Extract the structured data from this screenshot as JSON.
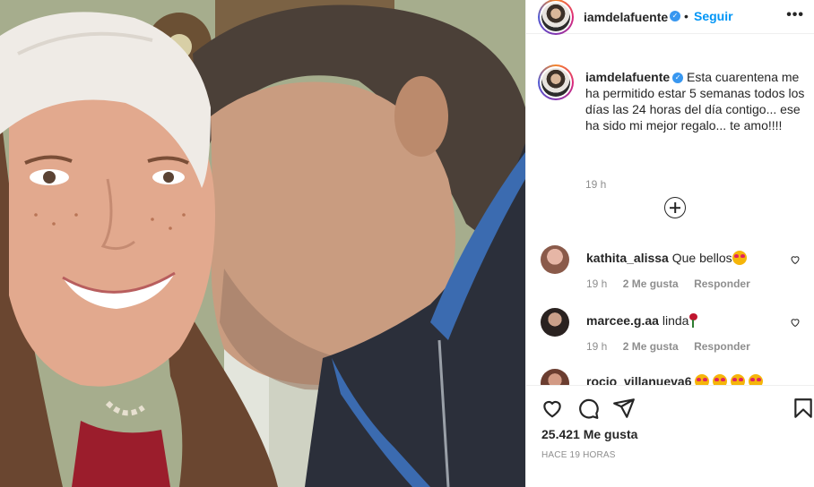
{
  "post": {
    "username": "iamdelafuente",
    "verified_icon": "verified-badge-icon",
    "separator": "•",
    "follow_label": "Seguir",
    "more_label": "•••",
    "caption": "Esta cuarentena me ha permitido estar 5 semanas todos los días las 24 horas del día contigo... ese ha sido mi mejor regalo... te amo!!!!",
    "caption_time": "19 h",
    "load_more_icon": "plus-circle-icon"
  },
  "comments": [
    {
      "username": "kathita_alissa",
      "text": "Que bellos",
      "emoji": "heart-eyes-emoji",
      "time": "19 h",
      "likes": "2 Me gusta",
      "reply": "Responder",
      "avatar_color": "#d6a39a"
    },
    {
      "username": "marcee.g.aa",
      "text": "linda",
      "emoji": "rose-emoji",
      "time": "19 h",
      "likes": "2 Me gusta",
      "reply": "Responder",
      "avatar_color": "#4a3b33"
    },
    {
      "username": "rocio_villanueva6",
      "text": "",
      "emoji": "heart-eyes-emoji",
      "avatar_color": "#7a4a3a"
    }
  ],
  "actions": {
    "like_icon": "heart-icon",
    "comment_icon": "comment-icon",
    "share_icon": "paper-plane-icon",
    "save_icon": "bookmark-icon",
    "likes_count": "25.421 Me gusta",
    "posted_ago": "HACE 19 HORAS"
  },
  "colors": {
    "link_blue": "#0095f6",
    "verified_blue": "#3897f0",
    "text": "#262626",
    "muted": "#8e8e8e"
  }
}
